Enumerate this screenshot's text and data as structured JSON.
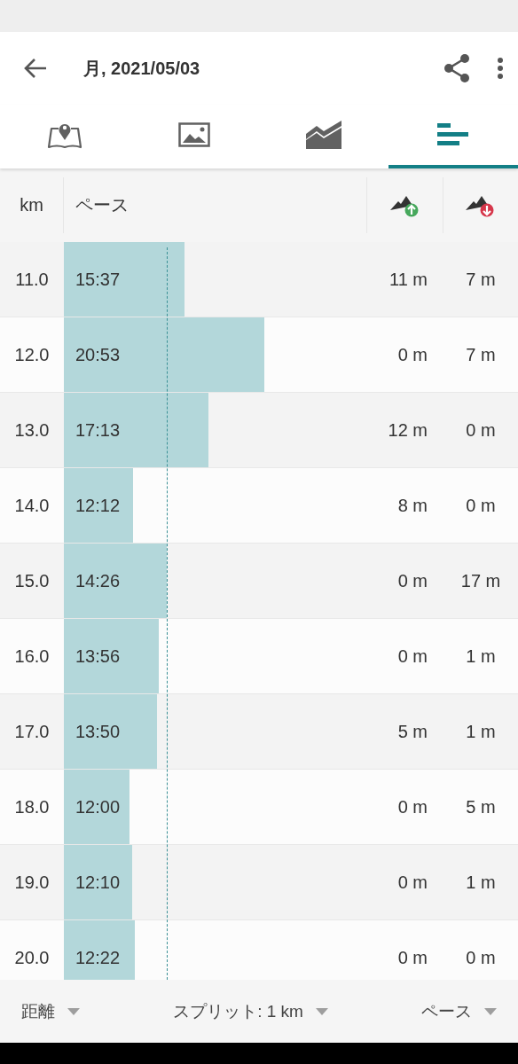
{
  "app_bar": {
    "title": "月, 2021/05/03"
  },
  "tabs": [
    {
      "selected": false
    },
    {
      "selected": false
    },
    {
      "selected": false
    },
    {
      "selected": true
    }
  ],
  "table": {
    "columns": [
      "km",
      "ペース"
    ],
    "rows": [
      {
        "km": "11.0",
        "pace": "15:37",
        "ascent": "11 m",
        "descent": "7 m"
      },
      {
        "km": "12.0",
        "pace": "20:53",
        "ascent": "0 m",
        "descent": "7 m"
      },
      {
        "km": "13.0",
        "pace": "17:13",
        "ascent": "12 m",
        "descent": "0 m"
      },
      {
        "km": "14.0",
        "pace": "12:12",
        "ascent": "8 m",
        "descent": "0 m"
      },
      {
        "km": "15.0",
        "pace": "14:26",
        "ascent": "0 m",
        "descent": "17 m"
      },
      {
        "km": "16.0",
        "pace": "13:56",
        "ascent": "0 m",
        "descent": "1 m"
      },
      {
        "km": "17.0",
        "pace": "13:50",
        "ascent": "5 m",
        "descent": "1 m"
      },
      {
        "km": "18.0",
        "pace": "12:00",
        "ascent": "0 m",
        "descent": "5 m"
      },
      {
        "km": "19.0",
        "pace": "12:10",
        "ascent": "0 m",
        "descent": "1 m"
      },
      {
        "km": "20.0",
        "pace": "12:22",
        "ascent": "0 m",
        "descent": "0 m"
      }
    ]
  },
  "footer": [
    "距離",
    "スプリット: 1 km",
    "ペース"
  ]
}
